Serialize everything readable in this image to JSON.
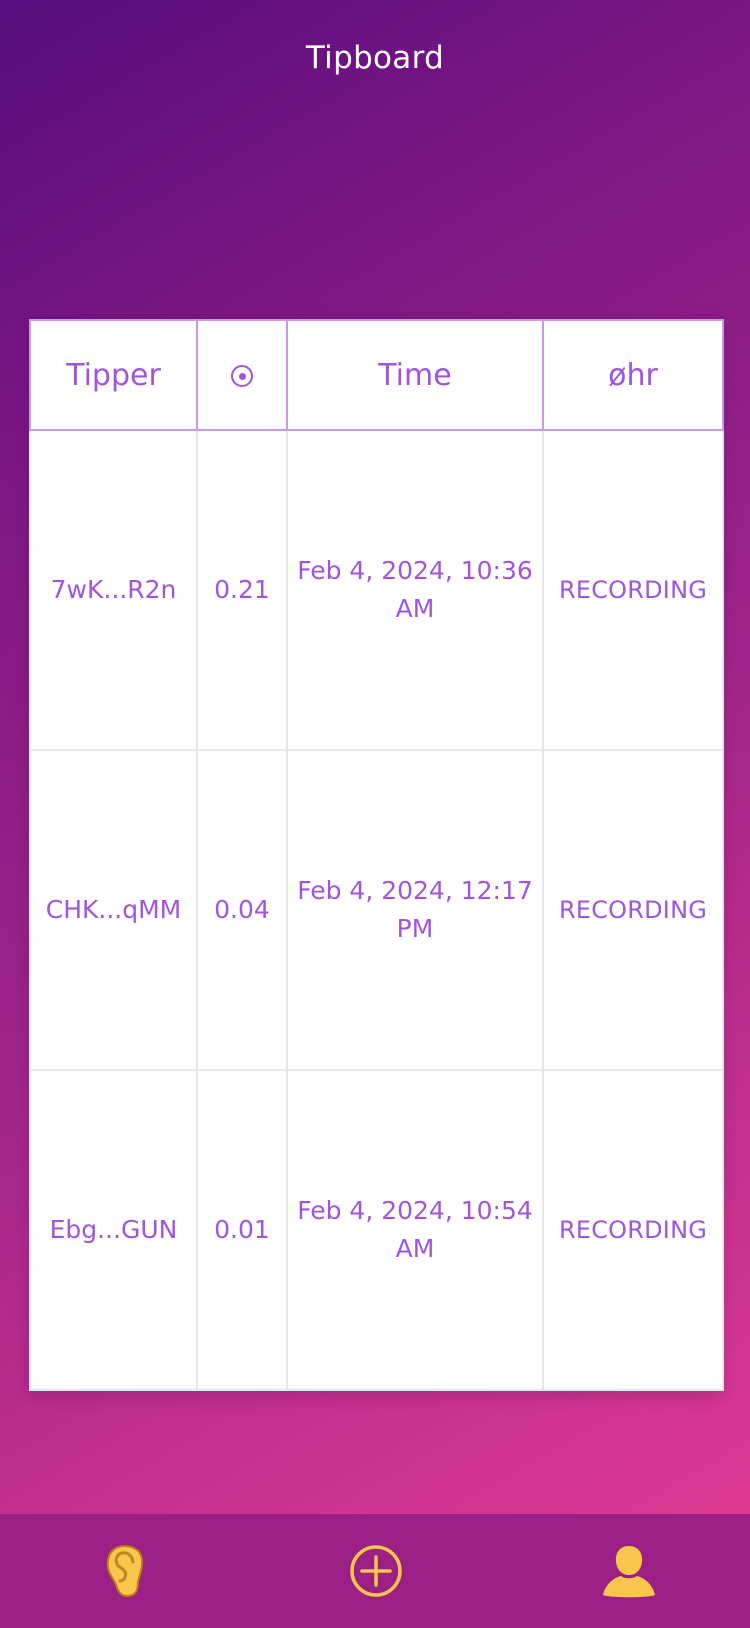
{
  "app": {
    "title": "Tipboard"
  },
  "table": {
    "columns": [
      {
        "label": "Tipper"
      },
      {
        "label": "",
        "icon": "target-icon"
      },
      {
        "label": "Time"
      },
      {
        "label": "øhr"
      }
    ],
    "rows": [
      {
        "tipper": "7wK...R2n",
        "amount": "0.21",
        "time": "Feb 4, 2024, 10:36 AM",
        "status": "RECORDING"
      },
      {
        "tipper": "CHK...qMM",
        "amount": "0.04",
        "time": "Feb 4, 2024, 12:17 PM",
        "status": "RECORDING"
      },
      {
        "tipper": "Ebg...GUN",
        "amount": "0.01",
        "time": "Feb 4, 2024, 10:54 AM",
        "status": "RECORDING"
      }
    ]
  },
  "bottom_nav": {
    "items": [
      {
        "icon": "ear-icon"
      },
      {
        "icon": "plus-circle-icon"
      },
      {
        "icon": "profile-icon"
      }
    ]
  },
  "colors": {
    "accent": "#a155dc",
    "nav_icon": "#f7c64a",
    "nav_background": "#9b1f84",
    "header_border": "#c99ae0",
    "cell_border": "#e6e6e6"
  }
}
